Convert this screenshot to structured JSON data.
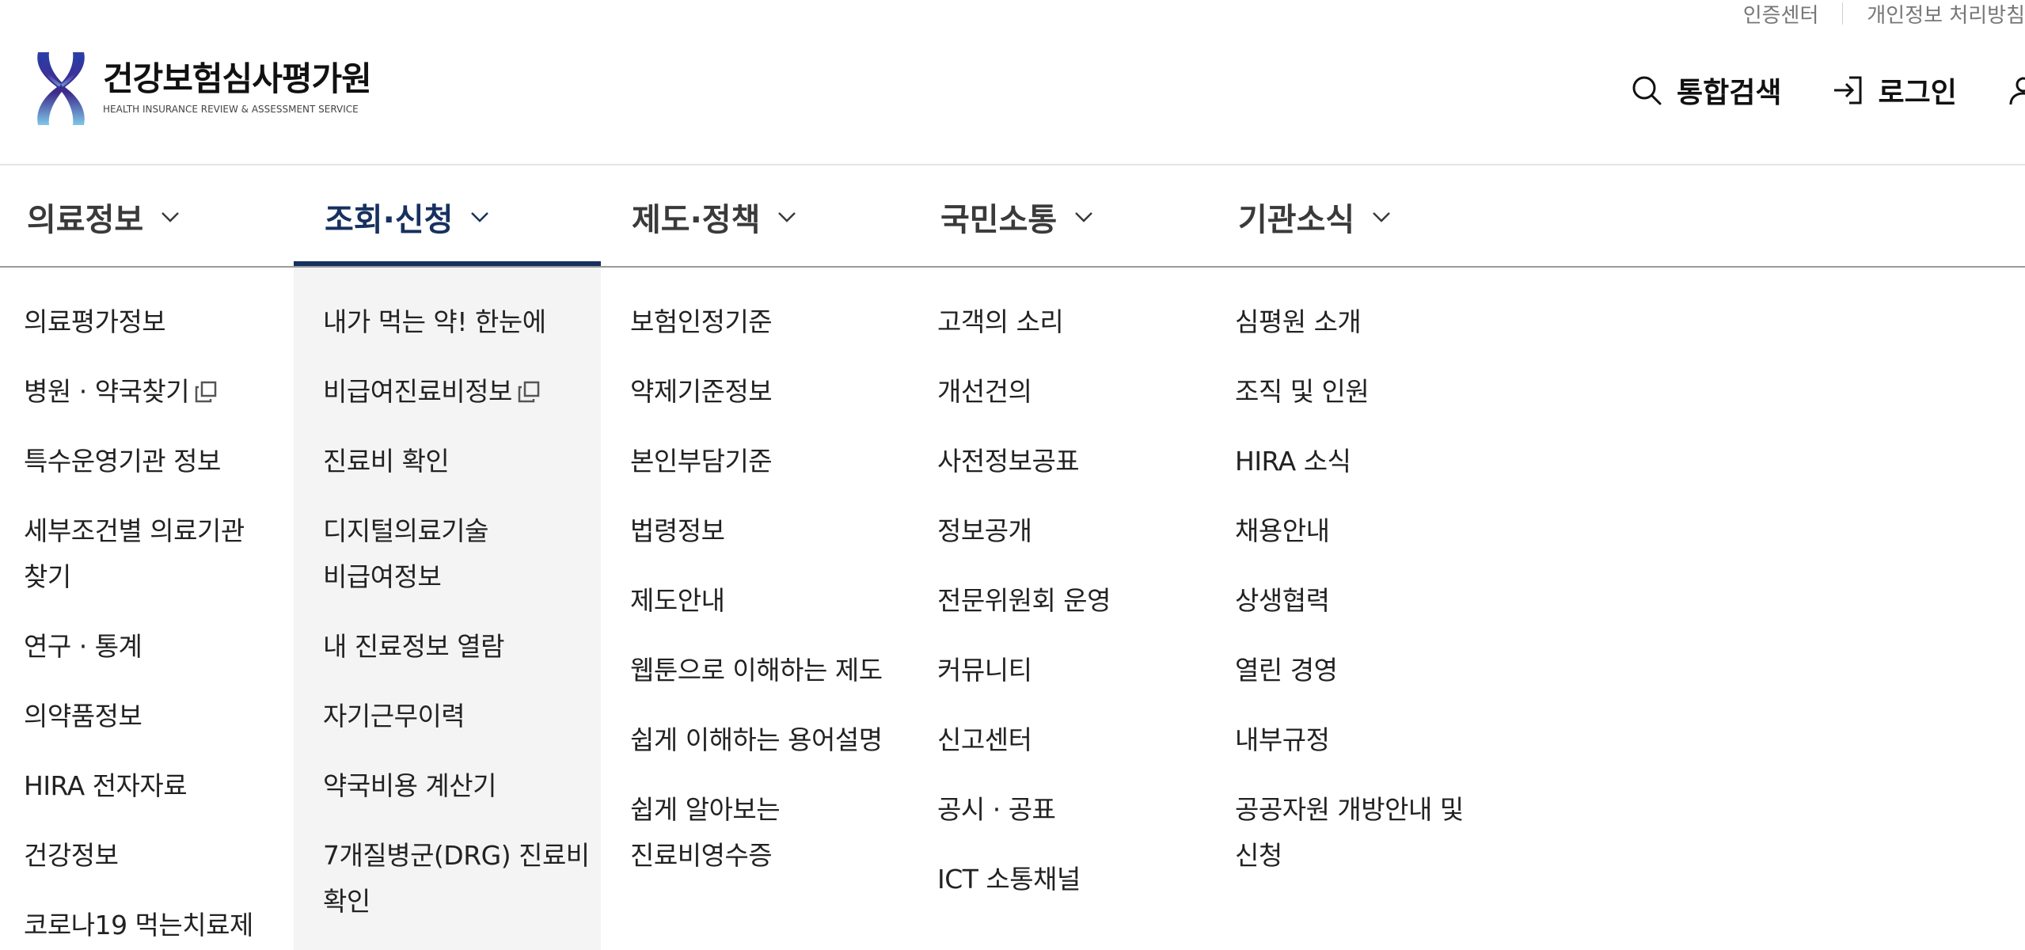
{
  "util": {
    "cert_center": "인증센터",
    "privacy_policy": "개인정보 처리방침"
  },
  "logo": {
    "kor": "건강보험심사평가원",
    "eng": "HEALTH INSURANCE REVIEW & ASSESSMENT SERVICE"
  },
  "top_actions": {
    "search": "통합검색",
    "login": "로그인"
  },
  "gnb": [
    {
      "label": "의료정보"
    },
    {
      "label": "조회·신청"
    },
    {
      "label": "제도·정책"
    },
    {
      "label": "국민소통"
    },
    {
      "label": "기관소식"
    }
  ],
  "submenu": {
    "col0": [
      "의료평가정보",
      "병원 · 약국찾기",
      "특수운영기관 정보",
      "세부조건별 의료기관\n찾기",
      "연구 · 통계",
      "의약품정보",
      "HIRA 전자자료",
      "건강정보",
      "코로나19 먹는치료제"
    ],
    "col1": [
      "내가 먹는 약! 한눈에",
      "비급여진료비정보",
      "진료비 확인",
      "디지털의료기술\n비급여정보",
      "내 진료정보 열람",
      "자기근무이력",
      "약국비용 계산기",
      "7개질병군(DRG) 진료비\n확인"
    ],
    "col2": [
      "보험인정기준",
      "약제기준정보",
      "본인부담기준",
      "법령정보",
      "제도안내",
      "웹툰으로 이해하는 제도",
      "쉽게 이해하는 용어설명",
      "쉽게 알아보는\n진료비영수증"
    ],
    "col3": [
      "고객의 소리",
      "개선건의",
      "사전정보공표",
      "정보공개",
      "전문위원회 운영",
      "커뮤니티",
      "신고센터",
      "공시 · 공표",
      "ICT 소통채널"
    ],
    "col4": [
      "심평원 소개",
      "조직 및 인원",
      "HIRA 소식",
      "채용안내",
      "상생협력",
      "열린 경영",
      "내부규정",
      "공공자원 개방안내 및\n신청"
    ]
  },
  "colors": {
    "brand_navy": "#16315f",
    "active_col_bg": "#f4f4f4"
  }
}
